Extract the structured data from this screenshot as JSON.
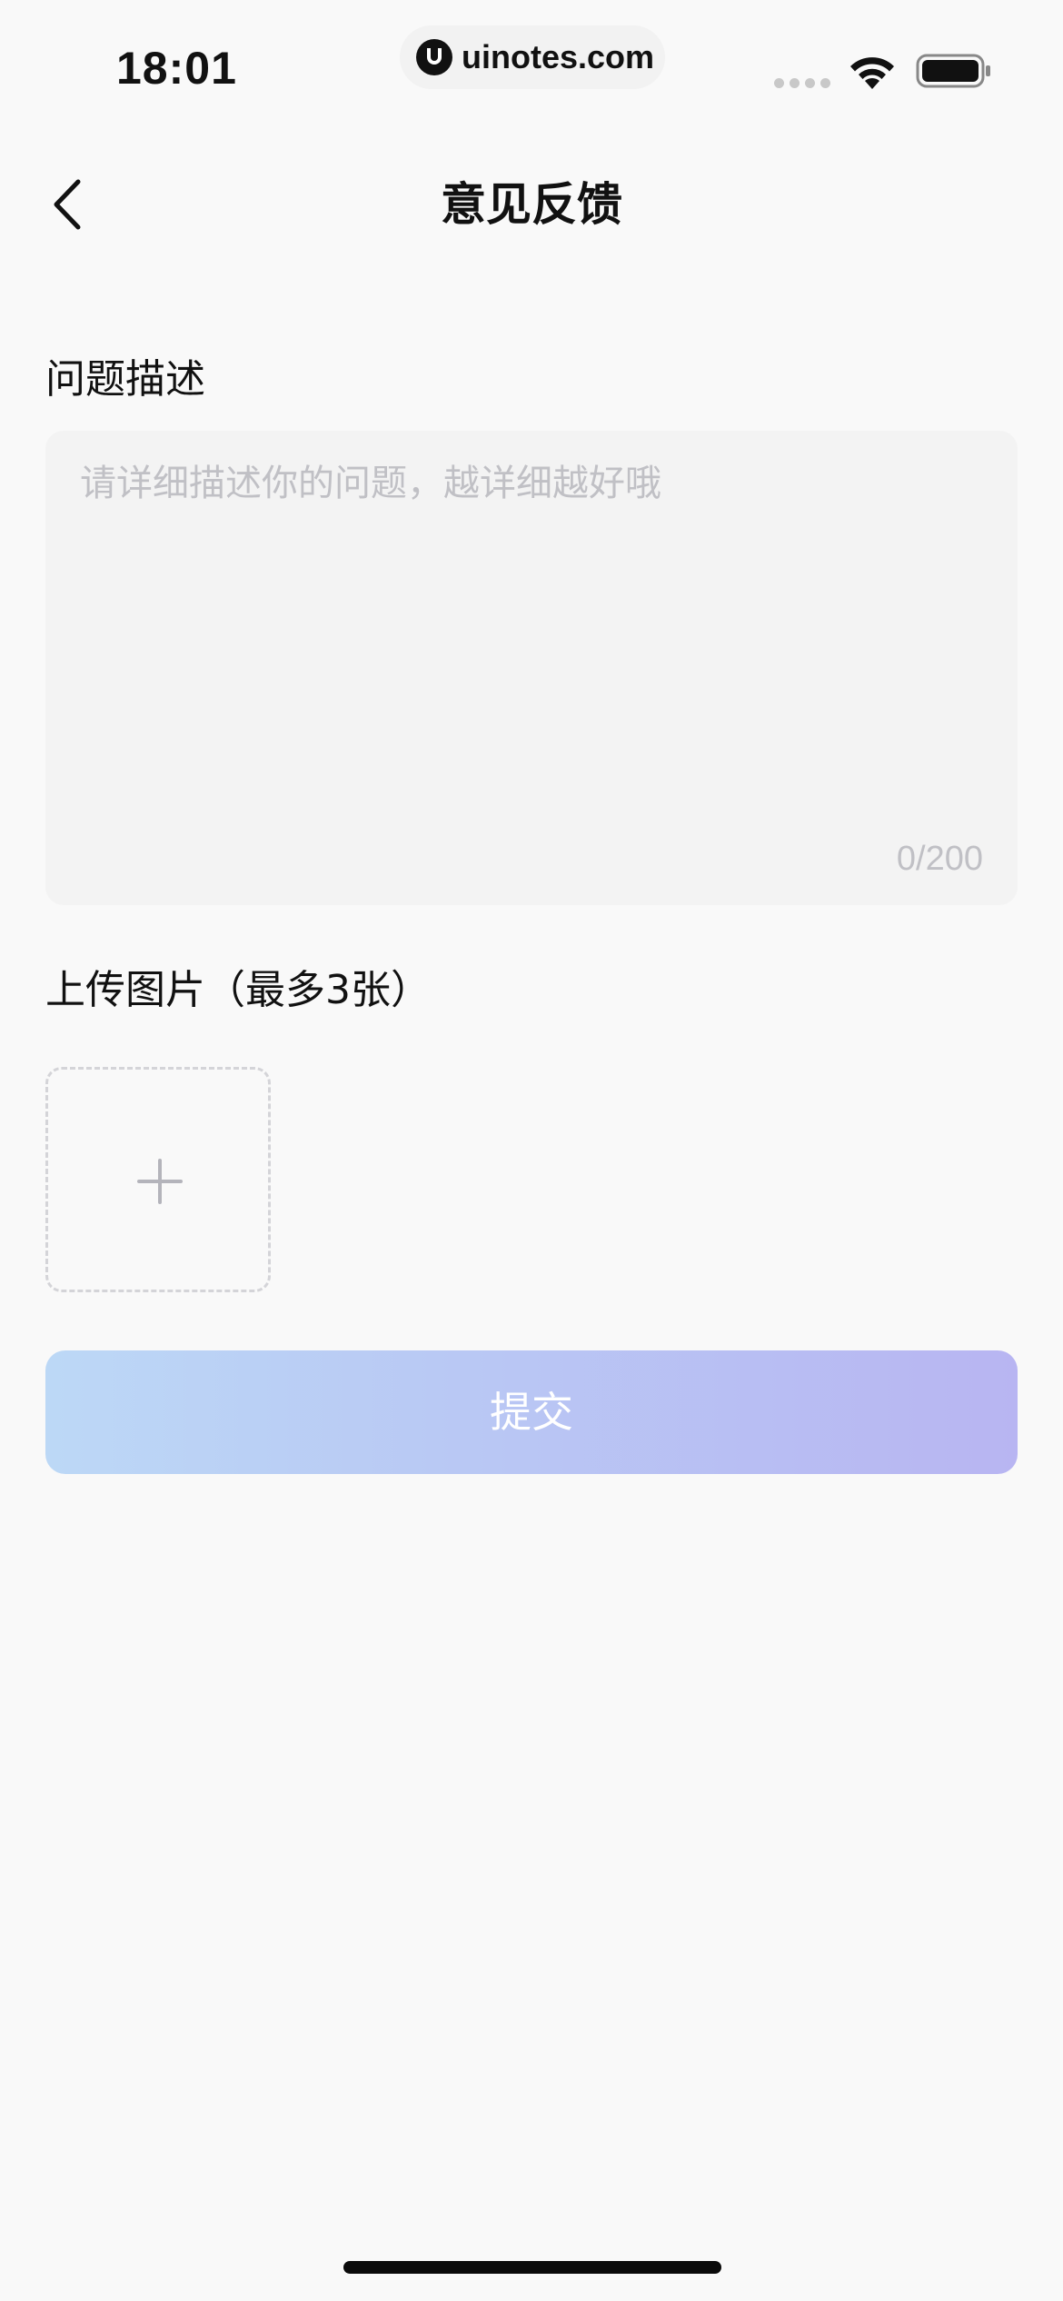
{
  "status_bar": {
    "time": "18:01",
    "watermark": "uinotes.com",
    "icons": [
      "signal-icon",
      "wifi-icon",
      "battery-icon"
    ]
  },
  "nav": {
    "title": "意见反馈",
    "back_icon": "chevron-left-icon"
  },
  "description": {
    "label": "问题描述",
    "value": "",
    "placeholder": "请详细描述你的问题，越详细越好哦",
    "char_count": "0/200"
  },
  "upload": {
    "label": "上传图片（最多3张）",
    "add_icon": "plus-icon"
  },
  "submit": {
    "label": "提交"
  },
  "colors": {
    "background": "#f9f9f9",
    "input_background": "#f3f3f3",
    "placeholder": "#c0c0c5",
    "button_gradient_start": "#bcd8f6",
    "button_gradient_end": "#b8b5f2"
  }
}
